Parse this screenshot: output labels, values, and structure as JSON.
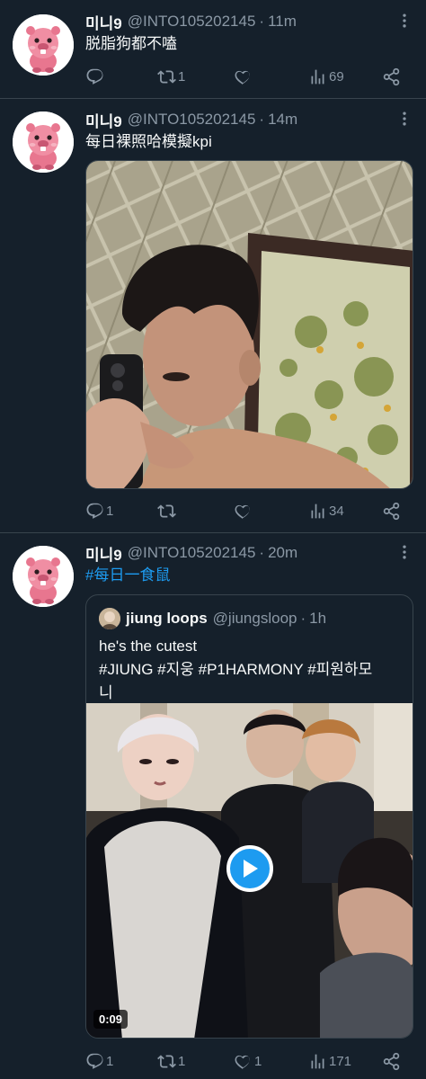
{
  "tweets": [
    {
      "author": "미니9",
      "handle": "@INTO105202145",
      "separator": "·",
      "time": "11m",
      "text": "脱脂狗都不嗑",
      "replies": "",
      "retweets": "1",
      "likes": "",
      "views": "69"
    },
    {
      "author": "미니9",
      "handle": "@INTO105202145",
      "separator": "·",
      "time": "14m",
      "text": "每日裸照哈模擬kpi",
      "replies": "1",
      "retweets": "",
      "likes": "",
      "views": "34"
    },
    {
      "author": "미니9",
      "handle": "@INTO105202145",
      "separator": "·",
      "time": "20m",
      "text": "#每日一食鼠",
      "replies": "1",
      "retweets": "1",
      "likes": "1",
      "views": "171",
      "quote": {
        "author": "jiung loops",
        "handle": "@jiungsloop",
        "separator": "·",
        "time": "1h",
        "line1": "he's the cutest",
        "line2": "#JIUNG #지웅 #P1HARMONY #피원하모",
        "line3": "니",
        "video_duration": "0:09"
      }
    }
  ],
  "icons": {
    "reply": "reply-icon",
    "retweet": "retweet-icon",
    "like": "heart-icon",
    "views": "views-icon",
    "share": "share-icon",
    "more": "more-icon",
    "play": "play-icon"
  },
  "colors": {
    "background": "#15202b",
    "text": "#f7f9f9",
    "secondary": "#8b98a5",
    "accent": "#1d9bf0",
    "border": "#38444d"
  }
}
